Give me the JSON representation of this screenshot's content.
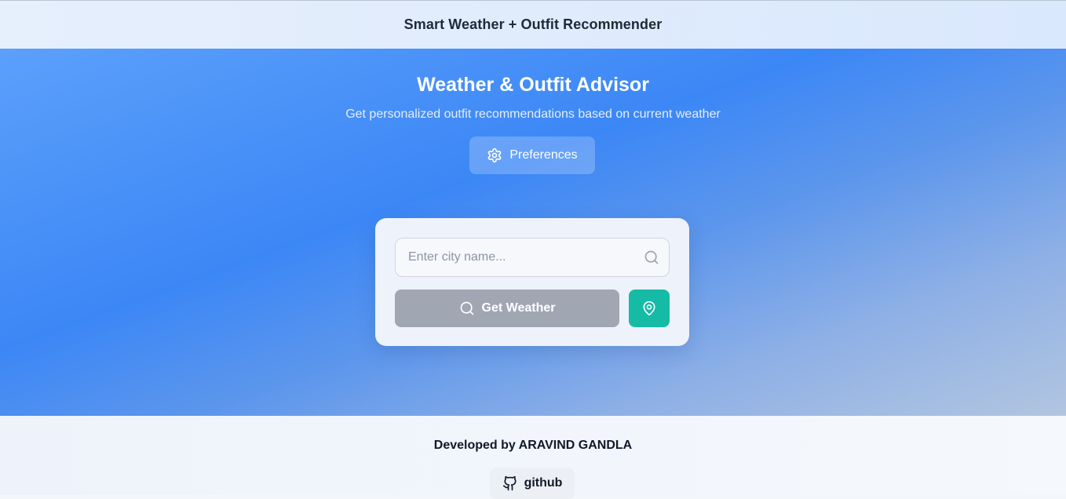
{
  "header": {
    "title": "Smart Weather + Outfit Recommender"
  },
  "hero": {
    "title": "Weather & Outfit Advisor",
    "subtitle": "Get personalized outfit recommendations based on current weather",
    "preferences_label": "Preferences",
    "preferences_icon": "gear-icon"
  },
  "search": {
    "placeholder": "Enter city name...",
    "value": "",
    "search_icon": "search-icon",
    "get_weather_label": "Get Weather",
    "get_weather_icon": "search-icon",
    "location_icon": "map-pin-icon"
  },
  "footer": {
    "credit": "Developed by ARAVIND GANDLA",
    "github_label": "github",
    "github_icon": "github-icon"
  },
  "colors": {
    "accent_teal": "#15bba5",
    "disabled_gray": "#a0a7b3",
    "hero_blue": "#3c87f6"
  }
}
